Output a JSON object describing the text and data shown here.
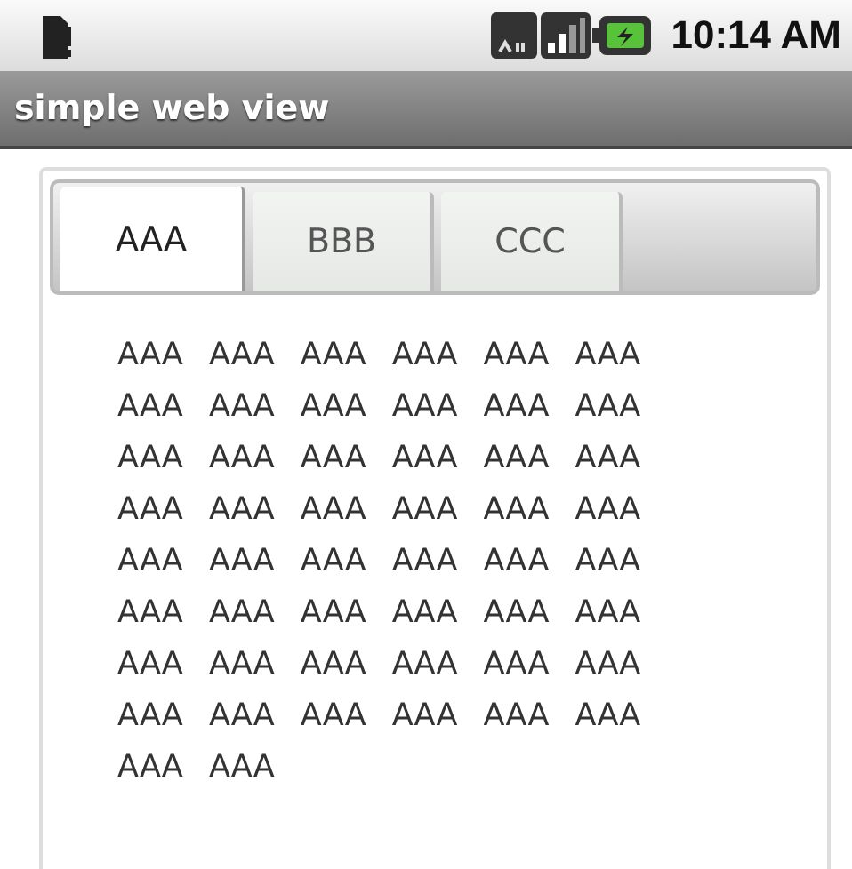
{
  "status_bar": {
    "time": "10:14 AM"
  },
  "title_bar": {
    "title": "simple web view"
  },
  "tabs": [
    {
      "label": "AAA",
      "selected": true
    },
    {
      "label": "BBB",
      "selected": false
    },
    {
      "label": "CCC",
      "selected": false
    }
  ],
  "content": {
    "text": "AAA AAA AAA AAA AAA AAA AAA AAA AAA AAA AAA AAA AAA AAA AAA AAA AAA AAA AAA AAA AAA AAA AAA AAA AAA AAA AAA AAA AAA AAA AAA AAA AAA AAA AAA AAA AAA AAA AAA AAA AAA AAA AAA AAA AAA AAA AAA AAA AAA AAA"
  }
}
